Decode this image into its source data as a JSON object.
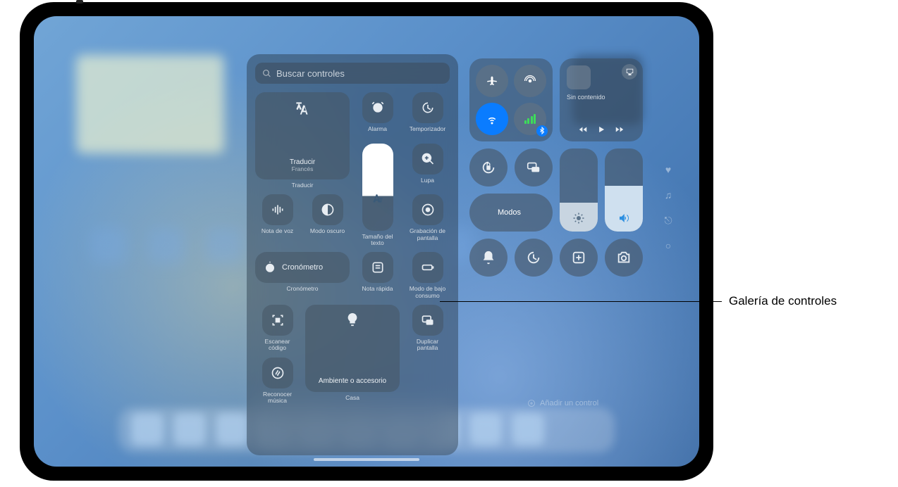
{
  "search": {
    "placeholder": "Buscar controles"
  },
  "gallery": {
    "translate_big": {
      "title": "Traducir",
      "subtitle": "Francés",
      "caption": "Traducir"
    },
    "alarm": "Alarma",
    "timer": "Temporizador",
    "magnifier": "Lupa",
    "text_size": "Tamaño del texto",
    "voice_memo": "Nota de voz",
    "dark_mode": "Modo oscuro",
    "screen_recording": "Grabación de pantalla",
    "stopwatch_big": "Cronómetro",
    "stopwatch_caption": "Cronómetro",
    "quick_note": "Nota rápida",
    "low_power": "Modo de bajo consumo",
    "scan_code": "Escanear código",
    "screen_mirroring": "Duplicar pantalla",
    "recognize_music": "Reconocer música",
    "home_big": {
      "title": "Ambiente o accesorio",
      "caption": "Casa"
    }
  },
  "cc": {
    "now_playing_empty": "Sin contenido",
    "focus_label": "Modos"
  },
  "add_control_label": "Añadir un control",
  "callout_label": "Galería de controles"
}
